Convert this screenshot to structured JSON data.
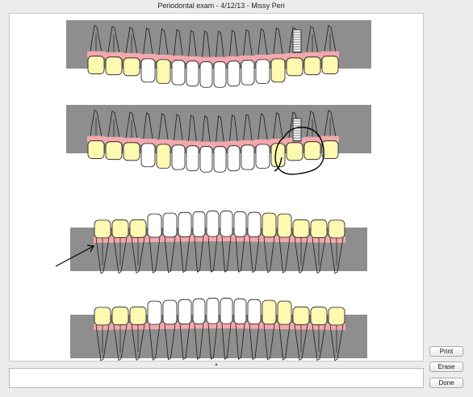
{
  "window": {
    "title": "Periodontal exam -  4/12/13 - Missy Peri"
  },
  "buttons": {
    "print": "Print",
    "erase": "Erase",
    "done": "Done"
  },
  "notes": {
    "value": ""
  },
  "colors": {
    "bone": "#8e8e8e",
    "gum": "#f4a8ad",
    "enamel": "#ffffff",
    "restoration": "#fdf9b0",
    "outline": "#1a1a1a"
  }
}
